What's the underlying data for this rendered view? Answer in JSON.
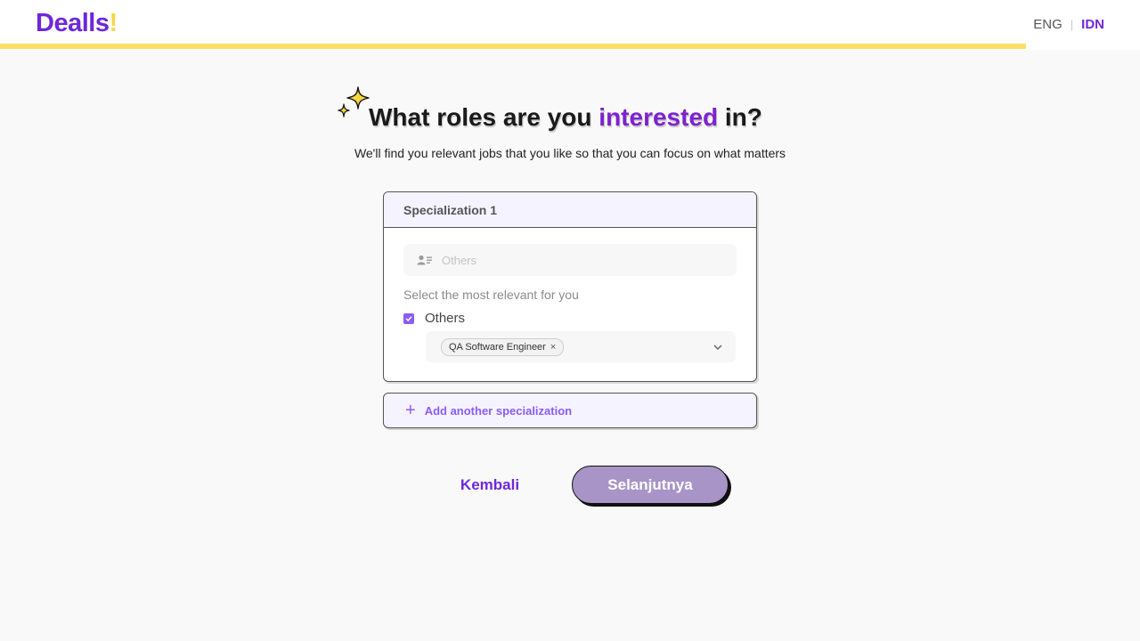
{
  "header": {
    "logo_text": "Dealls",
    "logo_mark": "!",
    "progress_fraction": 0.9,
    "progress_color": "#fbdf6a",
    "languages": {
      "eng": "ENG",
      "separator": "|",
      "idn": "IDN",
      "active": "IDN"
    }
  },
  "hero": {
    "title_before": "What roles are you ",
    "title_highlight": "interested",
    "title_after": " in?",
    "subtitle": "We'll find you relevant jobs that you like so that you can focus on what matters",
    "icon": "sparkles-icon"
  },
  "specialization": {
    "header": "Specialization 1",
    "search": {
      "placeholder": "Others",
      "value": "",
      "icon": "user-list-icon"
    },
    "hint": "Select the most relevant for you",
    "option": {
      "label": "Others",
      "checked": true
    },
    "roles": {
      "selected": [
        {
          "label": "QA Software Engineer",
          "remove": "×"
        }
      ],
      "icon": "chevron-down-icon"
    }
  },
  "add_specialization": {
    "label": "Add another specialization",
    "icon": "plus-icon"
  },
  "footer": {
    "back_label": "Kembali",
    "next_label": "Selanjutnya"
  },
  "colors": {
    "brand": "#6d28d9",
    "accent": "#8b5cf6",
    "next_button": "#a894c6",
    "highlight_yellow": "#f5d742"
  }
}
